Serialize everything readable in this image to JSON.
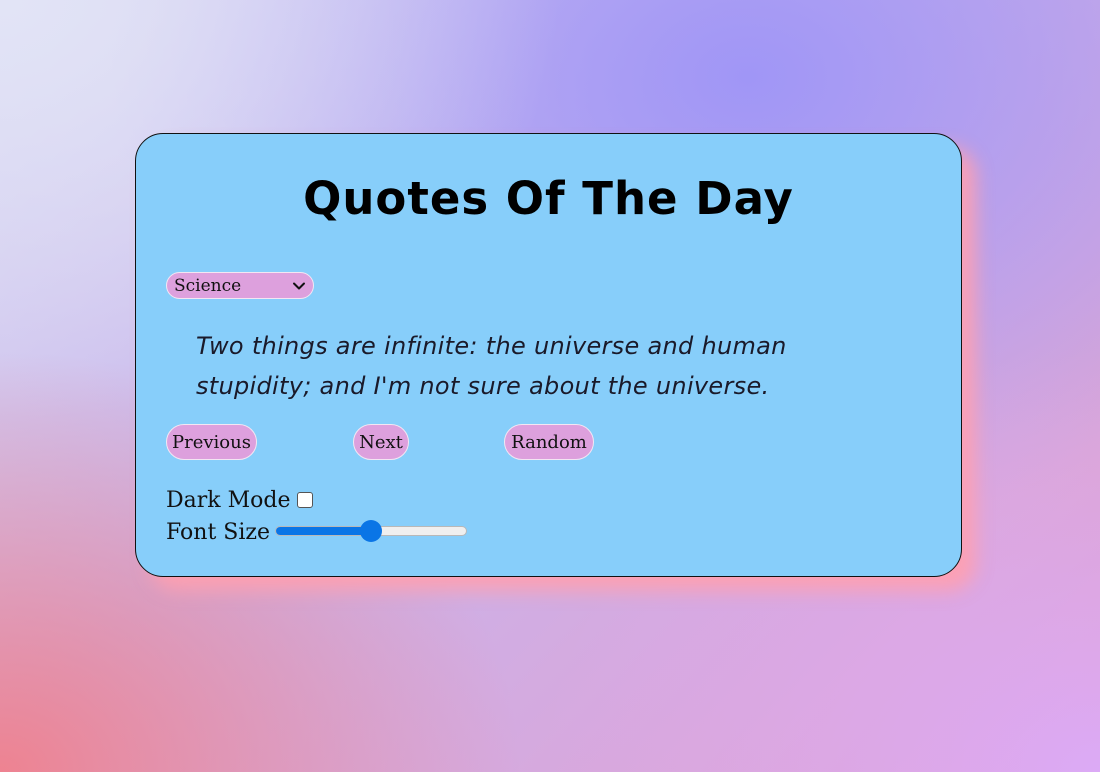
{
  "title": "Quotes Of The Day",
  "category": {
    "selected": "Science",
    "icon": "chevron-down-icon"
  },
  "quote": {
    "text": "Two things are infinite: the universe and human stupidity; and I'm not sure about the universe."
  },
  "buttons": {
    "previous": "Previous",
    "next": "Next",
    "random": "Random"
  },
  "settings": {
    "dark_mode_label": "Dark Mode",
    "dark_mode_checked": false,
    "font_size_label": "Font Size",
    "font_size_fraction": 0.5
  },
  "colors": {
    "card_bg": "#87cefa",
    "button_bg": "#dda0dd",
    "slider_accent": "#0a75e6"
  }
}
